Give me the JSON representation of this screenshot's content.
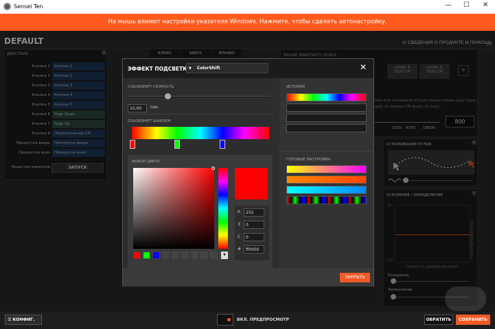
{
  "window": {
    "title": "Sensei Ten",
    "controls": [
      "—",
      "☐",
      "✕"
    ]
  },
  "banner": {
    "text": "На мышь влияют настройки указателя Windows. Нажмите, чтобы сделать автонастройку."
  },
  "profile": {
    "name": "DEFAULT"
  },
  "product_info": {
    "label": "СВЕДЕНИЯ О ПРОДУКТЕ И ПОМОЩЬ"
  },
  "actions": {
    "title": "ДЕЙСТВИЯ",
    "help": "?",
    "rows": [
      {
        "label": "Кнопка 1",
        "value": "Кнопка 1",
        "type": "blue"
      },
      {
        "label": "Кнопка 2",
        "value": "Кнопка 2",
        "type": "blue"
      },
      {
        "label": "Кнопка 3",
        "value": "Кнопка 3",
        "type": "blue"
      },
      {
        "label": "Кнопка 4",
        "value": "Кнопка 4",
        "type": "blue"
      },
      {
        "label": "Кнопка 5",
        "value": "Кнопка 5",
        "type": "blue"
      },
      {
        "label": "Кнопка 6",
        "value": "Page Down",
        "type": "green"
      },
      {
        "label": "Кнопка 7",
        "value": "Page Up",
        "type": "green"
      },
      {
        "label": "Кнопка 8",
        "value": "Переключение CPI",
        "type": "blue"
      },
      {
        "label": "Прокрутка вверх",
        "value": "Прокрутка вверх",
        "type": "blue"
      },
      {
        "label": "Прокрутка вниз",
        "value": "Прокрутка вниз",
        "type": "blue"
      }
    ],
    "macro_label": "Редактор макросов",
    "launch_button": "ЗАПУСК"
  },
  "side_tabs": [
    "ВЛЕВО",
    "ВВЕРХ",
    "ВПРАВО"
  ],
  "sensitivity": {
    "title": "MOUSE SENSITIVITY LEVELS",
    "tabs": [
      {
        "label": "LEVEL 4",
        "value": "3100 CPI"
      },
      {
        "label": "LEVEL 5",
        "value": "3200 CPI"
      }
    ],
    "add": "+",
    "description": "one-inch movement of your mouse moves your input, add, or remove CPI levels (5 max).",
    "scale": [
      "3200",
      "9200",
      "18000"
    ],
    "value_box": "800"
  },
  "angle_snapping": {
    "title": "СГЛАЖИВАНИЕ УГЛОВ",
    "help": "?"
  },
  "acceleration": {
    "title": "УСКОРЕНИЕ / ЗАМЕДЕЛЕНИЕ",
    "help": "?",
    "y_label": "ЧУВСТВИТЕЛЬНОСТЬ",
    "x_label": "СКОРОСТЬ ДВИЖЕНИЯ РУКИ",
    "y_max": "2x",
    "y_min": "1/2",
    "accel_label": "Ускорение",
    "decel_label": "Замедление"
  },
  "dialog": {
    "title": "ЭФФЕКТ ПОДСВЕТКИ",
    "effect": "ColorShift",
    "close": "✕",
    "speed_label": "COLORSHIFT СКОРОСТЬ",
    "speed_value": "10,00",
    "speed_unit": "сек.",
    "speed_fraction": 0.28,
    "template_label": "COLORSHIFT ШАБЛОН",
    "picker_label": "ВЫБОР ЦВЕТА",
    "current_color": "#ff0000",
    "rgb": [
      {
        "label": "К",
        "value": "255"
      },
      {
        "label": "З",
        "value": "0"
      },
      {
        "label": "С",
        "value": "0"
      }
    ],
    "hex_label": "#",
    "hex_value": "ff0000",
    "history_label": "ИСТОРИЯ",
    "presets_label": "ГОТОВЫЕ НАСТРОЙКИ",
    "close_button": "ЗАКРЫТЬ"
  },
  "bottom": {
    "config_button": "КОНФИГ.",
    "preview_label": "ВКЛ. ПРЕДПРОСМОТР",
    "revert_button": "ОБРАТИТЬ",
    "save_button": "СОХРАНИТЬ"
  },
  "colors": {
    "accent": "#f15a24",
    "banner": "#fe5a1d",
    "selected": "#ff0000"
  }
}
